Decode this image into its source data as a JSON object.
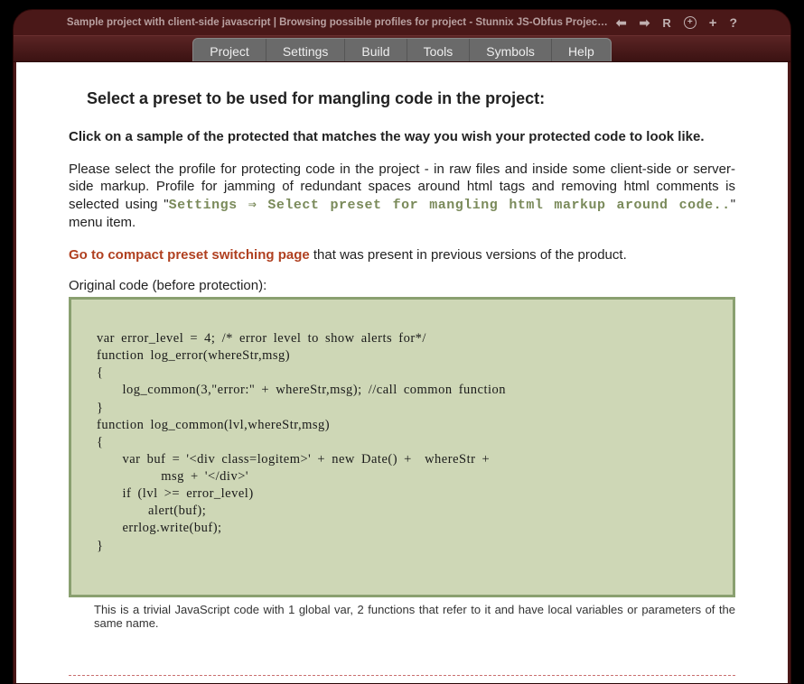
{
  "window": {
    "title": "Sample project with client-side javascript | Browsing possible profiles for project - Stunnix JS-Obfus Project Mana"
  },
  "toolbar_icons": {
    "back": "⬅",
    "forward": "➡",
    "reload": "R",
    "plus_circle": "+",
    "plus": "+",
    "help": "?"
  },
  "menu": {
    "items": [
      "Project",
      "Settings",
      "Build",
      "Tools",
      "Symbols",
      "Help"
    ]
  },
  "page": {
    "heading": "Select a preset to be used for mangling code in the project:",
    "intro_bold": "Click on a sample of the protected that matches the way you wish your protected code to look like.",
    "para2_pre": "Please select the profile for protecting code in the project - in raw files and inside some client-side or server-side markup. Profile for jamming of redundant spaces around html tags and removing html comments is selected using \"",
    "para2_menu": "Settings ⇒ Select preset for mangling html markup around code..",
    "para2_post": "\" menu item.",
    "compact_link": "Go to compact preset switching page",
    "compact_rest": " that was present in previous versions of the product.",
    "orig_label": "Original code (before protection):",
    "code": "var error_level = 4; /* error level to show alerts for*/\nfunction log_error(whereStr,msg)\n{\n    log_common(3,\"error:\" + whereStr,msg); //call common function\n}\nfunction log_common(lvl,whereStr,msg)\n{\n    var buf = '<div class=logitem>' + new Date() +  whereStr +\n          msg + '</div>'\n    if (lvl >= error_level)\n        alert(buf);\n    errlog.write(buf);\n}",
    "caption": "This is a trivial JavaScript code with 1 global var, 2 functions that refer to it and have local variables or parameters of the same name."
  }
}
